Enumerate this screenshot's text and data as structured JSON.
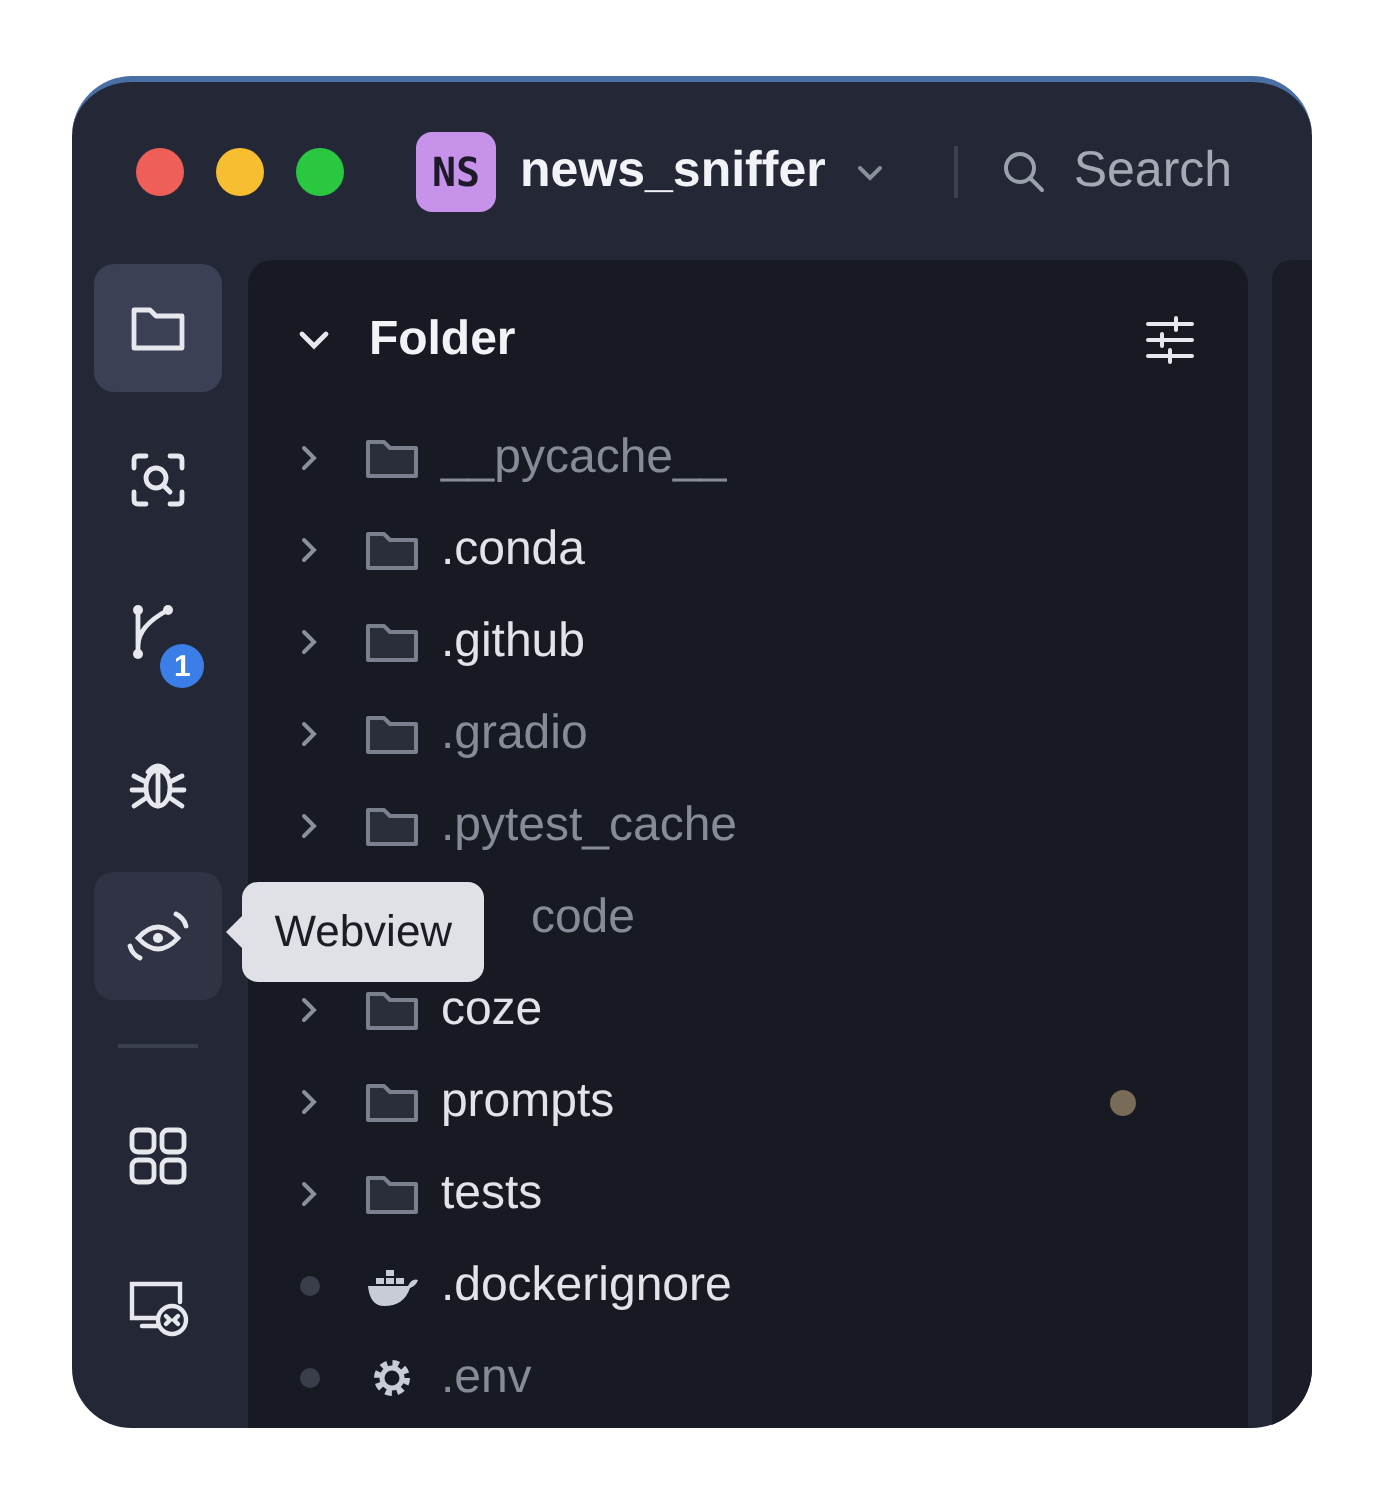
{
  "titlebar": {
    "project_initials": "NS",
    "project_name": "news_sniffer",
    "search_label": "Search"
  },
  "activity_bar": [
    {
      "kind": "folder",
      "selected": true,
      "hovered": false
    },
    {
      "kind": "scan",
      "selected": false,
      "hovered": false
    },
    {
      "kind": "git",
      "selected": false,
      "hovered": false,
      "badge": "1"
    },
    {
      "kind": "bug",
      "selected": false,
      "hovered": false
    },
    {
      "kind": "eye",
      "selected": false,
      "hovered": true,
      "tooltip": "Webview"
    },
    {
      "kind": "divider"
    },
    {
      "kind": "grid",
      "selected": false,
      "hovered": false
    },
    {
      "kind": "remote",
      "selected": false,
      "hovered": false
    }
  ],
  "explorer": {
    "title": "Folder",
    "expanded": true,
    "items": [
      {
        "kind": "folder",
        "name": "__pycache__",
        "dimmed": true,
        "modified": false
      },
      {
        "kind": "folder",
        "name": ".conda",
        "dimmed": false,
        "modified": false
      },
      {
        "kind": "folder",
        "name": ".github",
        "dimmed": false,
        "modified": false
      },
      {
        "kind": "folder",
        "name": ".gradio",
        "dimmed": true,
        "modified": false
      },
      {
        "kind": "folder",
        "name": ".pytest_cache",
        "dimmed": true,
        "modified": false
      },
      {
        "kind": "covered",
        "name": "code",
        "dimmed": true,
        "modified": false
      },
      {
        "kind": "folder",
        "name": "coze",
        "dimmed": false,
        "modified": false
      },
      {
        "kind": "folder",
        "name": "prompts",
        "dimmed": false,
        "modified": true
      },
      {
        "kind": "folder",
        "name": "tests",
        "dimmed": false,
        "modified": false
      },
      {
        "kind": "docker",
        "name": ".dockerignore",
        "dimmed": false,
        "modified": false
      },
      {
        "kind": "gear",
        "name": ".env",
        "dimmed": true,
        "modified": false
      }
    ]
  }
}
